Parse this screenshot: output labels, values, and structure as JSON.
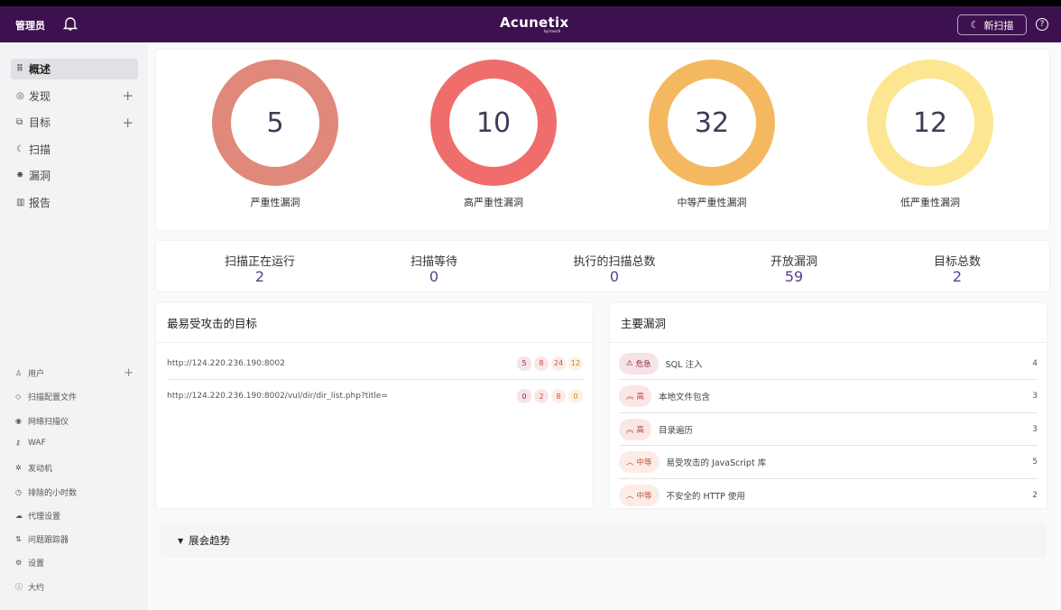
{
  "header": {
    "user": "管理员",
    "logo": "Acunetix",
    "logo_sub": "by Invicti",
    "new_scan": "新扫描",
    "help": "?"
  },
  "sidebar": {
    "main": [
      {
        "label": "概述",
        "icon": "grid-icon",
        "glyph": "⠿",
        "plus": false
      },
      {
        "label": "发现",
        "icon": "target-icon",
        "glyph": "◎",
        "plus": true
      },
      {
        "label": "目标",
        "icon": "targets-icon",
        "glyph": "⧉",
        "plus": true
      },
      {
        "label": "扫描",
        "icon": "scan-icon",
        "glyph": "☾",
        "plus": false
      },
      {
        "label": "漏洞",
        "icon": "bug-icon",
        "glyph": "✸",
        "plus": false
      },
      {
        "label": "报告",
        "icon": "chart-icon",
        "glyph": "▥",
        "plus": false
      }
    ],
    "bottom": [
      {
        "label": "用户",
        "icon": "user-icon",
        "glyph": "♙",
        "plus": true
      },
      {
        "label": "扫描配置文件",
        "icon": "shield-icon",
        "glyph": "◇",
        "plus": false
      },
      {
        "label": "网络扫描仪",
        "icon": "network-icon",
        "glyph": "◉",
        "plus": false
      },
      {
        "label": "WAF",
        "icon": "key-icon",
        "glyph": "⚷",
        "plus": false
      },
      {
        "label": "发动机",
        "icon": "engine-icon",
        "glyph": "✲",
        "plus": false
      },
      {
        "label": "排除的小时数",
        "icon": "clock-icon",
        "glyph": "◷",
        "plus": false
      },
      {
        "label": "代理设置",
        "icon": "cloud-icon",
        "glyph": "☁",
        "plus": false
      },
      {
        "label": "问题跟踪器",
        "icon": "tracker-icon",
        "glyph": "⇅",
        "plus": false
      },
      {
        "label": "设置",
        "icon": "gear-icon",
        "glyph": "⚙",
        "plus": false
      },
      {
        "label": "大约",
        "icon": "info-icon",
        "glyph": "ⓘ",
        "plus": false
      }
    ]
  },
  "donuts": [
    {
      "value": "5",
      "label": "严重性漏洞",
      "color": "#e0887a"
    },
    {
      "value": "10",
      "label": "高严重性漏洞",
      "color": "#ef6d6b"
    },
    {
      "value": "32",
      "label": "中等严重性漏洞",
      "color": "#f4b960"
    },
    {
      "value": "12",
      "label": "低严重性漏洞",
      "color": "#fde691"
    }
  ],
  "stats": [
    {
      "label": "扫描正在运行",
      "value": "2"
    },
    {
      "label": "扫描等待",
      "value": "0"
    },
    {
      "label": "执行的扫描总数",
      "value": "0"
    },
    {
      "label": "开放漏洞",
      "value": "59"
    },
    {
      "label": "目标总数",
      "value": "2"
    }
  ],
  "targets": {
    "title": "最易受攻击的目标",
    "rows": [
      {
        "url": "http://124.220.236.190:8002",
        "counts": [
          "5",
          "8",
          "24",
          "12"
        ]
      },
      {
        "url": "http://124.220.236.190:8002/vul/dir/dir_list.php?title=",
        "counts": [
          "0",
          "2",
          "8",
          "0"
        ]
      }
    ]
  },
  "vulns": {
    "title": "主要漏洞",
    "rows": [
      {
        "severity": "危急",
        "glyph": "⚠",
        "name": "SQL 注入",
        "count": "4",
        "bg": "#f6e3e5",
        "fg": "#8a2a3a"
      },
      {
        "severity": "高",
        "glyph": "︽",
        "name": "本地文件包含",
        "count": "3",
        "bg": "#fbe6e6",
        "fg": "#c0484a"
      },
      {
        "severity": "高",
        "glyph": "︽",
        "name": "目录遍历",
        "count": "3",
        "bg": "#fbe6e6",
        "fg": "#c0484a"
      },
      {
        "severity": "中等",
        "glyph": "︿",
        "name": "易受攻击的 JavaScript 库",
        "count": "5",
        "bg": "#fdece6",
        "fg": "#c0583a"
      },
      {
        "severity": "中等",
        "glyph": "︿",
        "name": "不安全的 HTTP 使用",
        "count": "2",
        "bg": "#fdece6",
        "fg": "#c0583a"
      }
    ]
  },
  "trend": {
    "label": "展会趋势"
  }
}
